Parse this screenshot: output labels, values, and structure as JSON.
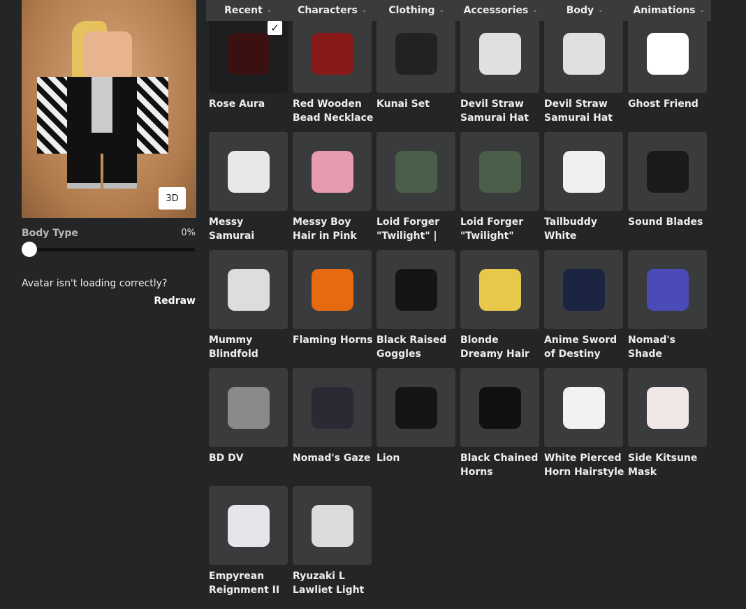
{
  "nav": {
    "tabs": [
      {
        "label": "Recent"
      },
      {
        "label": "Characters"
      },
      {
        "label": "Clothing"
      },
      {
        "label": "Accessories"
      },
      {
        "label": "Body"
      },
      {
        "label": "Animations"
      }
    ]
  },
  "preview": {
    "button_3d": "3D",
    "body_type_label": "Body Type",
    "body_type_value": "0%",
    "body_type_fraction": 0,
    "loading_question": "Avatar isn't loading correctly?",
    "redraw": "Redraw"
  },
  "items": [
    {
      "name": "Rose Aura",
      "selected": true,
      "color": "#3a1010"
    },
    {
      "name": "Red Wooden Bead Necklace",
      "color": "#8a1a1a"
    },
    {
      "name": "Kunai Set",
      "color": "#222222"
    },
    {
      "name": "Devil Straw Samurai Hat",
      "color": "#e0e0e0"
    },
    {
      "name": "Devil Straw Samurai Hat",
      "color": "#e0e0e0"
    },
    {
      "name": "Ghost Friend",
      "color": "#ffffff"
    },
    {
      "name": "Messy Samurai Ponytail in",
      "color": "#e8e8e8"
    },
    {
      "name": "Messy Boy Hair in Pink",
      "color": "#e89ab0"
    },
    {
      "name": "Loid Forger \"Twilight\" |",
      "color": "#4a5e4a"
    },
    {
      "name": "Loid Forger \"Twilight\"",
      "color": "#4a5e4a"
    },
    {
      "name": "Tailbuddy White",
      "color": "#f0f0f0"
    },
    {
      "name": "Sound Blades",
      "color": "#1a1a1a"
    },
    {
      "name": "Mummy Blindfold",
      "color": "#dddddd"
    },
    {
      "name": "Flaming Horns",
      "color": "#e86a10"
    },
    {
      "name": "Black Raised Goggles",
      "color": "#151515"
    },
    {
      "name": "Blonde Dreamy Hair",
      "color": "#e8c84a"
    },
    {
      "name": "Anime Sword of Destiny",
      "color": "#1b2440"
    },
    {
      "name": "Nomad's Shade",
      "color": "#4a4ab8"
    },
    {
      "name": "BD DV",
      "color": "#8a8a8a"
    },
    {
      "name": "Nomad's Gaze",
      "color": "#2a2a34"
    },
    {
      "name": "Lion",
      "color": "#151515"
    },
    {
      "name": "Black Chained Horns",
      "color": "#111111"
    },
    {
      "name": "White Pierced Horn Hairstyle",
      "color": "#f2f2f2"
    },
    {
      "name": "Side Kitsune Mask",
      "color": "#f0e6e6"
    },
    {
      "name": "Empyrean Reignment II",
      "color": "#e6e6ea"
    },
    {
      "name": "Ryuzaki L Lawliet Light",
      "color": "#dcdcdc"
    }
  ]
}
